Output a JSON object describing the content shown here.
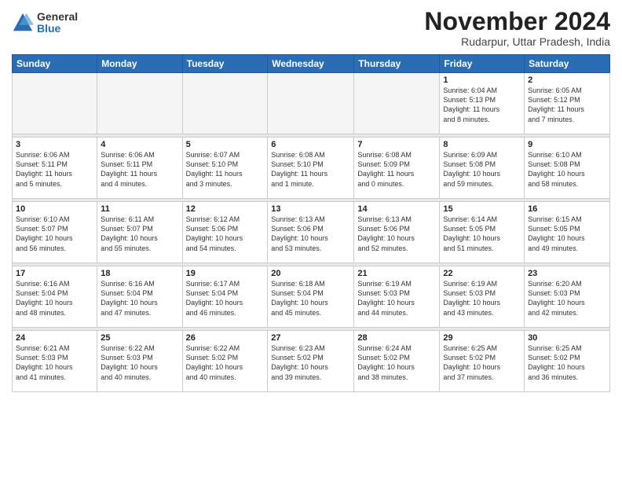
{
  "logo": {
    "general": "General",
    "blue": "Blue"
  },
  "title": "November 2024",
  "location": "Rudarpur, Uttar Pradesh, India",
  "days_of_week": [
    "Sunday",
    "Monday",
    "Tuesday",
    "Wednesday",
    "Thursday",
    "Friday",
    "Saturday"
  ],
  "weeks": [
    [
      {
        "day": "",
        "info": ""
      },
      {
        "day": "",
        "info": ""
      },
      {
        "day": "",
        "info": ""
      },
      {
        "day": "",
        "info": ""
      },
      {
        "day": "",
        "info": ""
      },
      {
        "day": "1",
        "info": "Sunrise: 6:04 AM\nSunset: 5:13 PM\nDaylight: 11 hours\nand 8 minutes."
      },
      {
        "day": "2",
        "info": "Sunrise: 6:05 AM\nSunset: 5:12 PM\nDaylight: 11 hours\nand 7 minutes."
      }
    ],
    [
      {
        "day": "3",
        "info": "Sunrise: 6:06 AM\nSunset: 5:11 PM\nDaylight: 11 hours\nand 5 minutes."
      },
      {
        "day": "4",
        "info": "Sunrise: 6:06 AM\nSunset: 5:11 PM\nDaylight: 11 hours\nand 4 minutes."
      },
      {
        "day": "5",
        "info": "Sunrise: 6:07 AM\nSunset: 5:10 PM\nDaylight: 11 hours\nand 3 minutes."
      },
      {
        "day": "6",
        "info": "Sunrise: 6:08 AM\nSunset: 5:10 PM\nDaylight: 11 hours\nand 1 minute."
      },
      {
        "day": "7",
        "info": "Sunrise: 6:08 AM\nSunset: 5:09 PM\nDaylight: 11 hours\nand 0 minutes."
      },
      {
        "day": "8",
        "info": "Sunrise: 6:09 AM\nSunset: 5:08 PM\nDaylight: 10 hours\nand 59 minutes."
      },
      {
        "day": "9",
        "info": "Sunrise: 6:10 AM\nSunset: 5:08 PM\nDaylight: 10 hours\nand 58 minutes."
      }
    ],
    [
      {
        "day": "10",
        "info": "Sunrise: 6:10 AM\nSunset: 5:07 PM\nDaylight: 10 hours\nand 56 minutes."
      },
      {
        "day": "11",
        "info": "Sunrise: 6:11 AM\nSunset: 5:07 PM\nDaylight: 10 hours\nand 55 minutes."
      },
      {
        "day": "12",
        "info": "Sunrise: 6:12 AM\nSunset: 5:06 PM\nDaylight: 10 hours\nand 54 minutes."
      },
      {
        "day": "13",
        "info": "Sunrise: 6:13 AM\nSunset: 5:06 PM\nDaylight: 10 hours\nand 53 minutes."
      },
      {
        "day": "14",
        "info": "Sunrise: 6:13 AM\nSunset: 5:06 PM\nDaylight: 10 hours\nand 52 minutes."
      },
      {
        "day": "15",
        "info": "Sunrise: 6:14 AM\nSunset: 5:05 PM\nDaylight: 10 hours\nand 51 minutes."
      },
      {
        "day": "16",
        "info": "Sunrise: 6:15 AM\nSunset: 5:05 PM\nDaylight: 10 hours\nand 49 minutes."
      }
    ],
    [
      {
        "day": "17",
        "info": "Sunrise: 6:16 AM\nSunset: 5:04 PM\nDaylight: 10 hours\nand 48 minutes."
      },
      {
        "day": "18",
        "info": "Sunrise: 6:16 AM\nSunset: 5:04 PM\nDaylight: 10 hours\nand 47 minutes."
      },
      {
        "day": "19",
        "info": "Sunrise: 6:17 AM\nSunset: 5:04 PM\nDaylight: 10 hours\nand 46 minutes."
      },
      {
        "day": "20",
        "info": "Sunrise: 6:18 AM\nSunset: 5:04 PM\nDaylight: 10 hours\nand 45 minutes."
      },
      {
        "day": "21",
        "info": "Sunrise: 6:19 AM\nSunset: 5:03 PM\nDaylight: 10 hours\nand 44 minutes."
      },
      {
        "day": "22",
        "info": "Sunrise: 6:19 AM\nSunset: 5:03 PM\nDaylight: 10 hours\nand 43 minutes."
      },
      {
        "day": "23",
        "info": "Sunrise: 6:20 AM\nSunset: 5:03 PM\nDaylight: 10 hours\nand 42 minutes."
      }
    ],
    [
      {
        "day": "24",
        "info": "Sunrise: 6:21 AM\nSunset: 5:03 PM\nDaylight: 10 hours\nand 41 minutes."
      },
      {
        "day": "25",
        "info": "Sunrise: 6:22 AM\nSunset: 5:03 PM\nDaylight: 10 hours\nand 40 minutes."
      },
      {
        "day": "26",
        "info": "Sunrise: 6:22 AM\nSunset: 5:02 PM\nDaylight: 10 hours\nand 40 minutes."
      },
      {
        "day": "27",
        "info": "Sunrise: 6:23 AM\nSunset: 5:02 PM\nDaylight: 10 hours\nand 39 minutes."
      },
      {
        "day": "28",
        "info": "Sunrise: 6:24 AM\nSunset: 5:02 PM\nDaylight: 10 hours\nand 38 minutes."
      },
      {
        "day": "29",
        "info": "Sunrise: 6:25 AM\nSunset: 5:02 PM\nDaylight: 10 hours\nand 37 minutes."
      },
      {
        "day": "30",
        "info": "Sunrise: 6:25 AM\nSunset: 5:02 PM\nDaylight: 10 hours\nand 36 minutes."
      }
    ]
  ]
}
